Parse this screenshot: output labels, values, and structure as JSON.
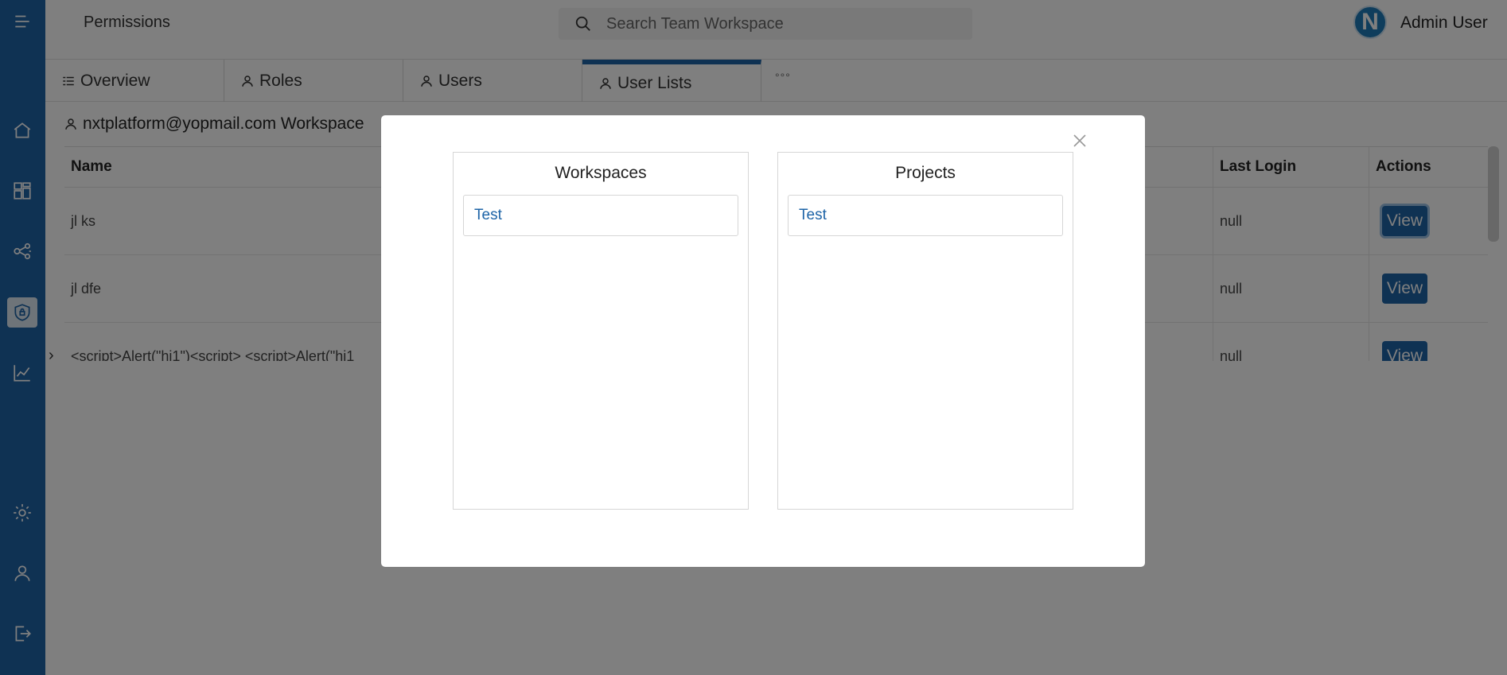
{
  "header": {
    "page_title": "Permissions",
    "search_placeholder": "Search Team Workspace",
    "avatar_letter": "N",
    "user_name": "Admin User"
  },
  "sidebar": {
    "items": [
      {
        "icon": "menu-icon"
      },
      {
        "icon": "home-icon"
      },
      {
        "icon": "dashboard-icon"
      },
      {
        "icon": "network-icon"
      },
      {
        "icon": "shield-lock-icon",
        "active": true
      },
      {
        "icon": "chart-icon"
      },
      {
        "icon": "gear-icon"
      },
      {
        "icon": "user-icon"
      },
      {
        "icon": "logout-icon"
      }
    ]
  },
  "tabs": {
    "overview": "Overview",
    "roles": "Roles",
    "users": "Users",
    "user_lists": "User Lists",
    "more": "°°°",
    "active": "User Lists"
  },
  "content": {
    "heading": "nxtplatform@yopmail.com Workspace",
    "columns": {
      "name": "Name",
      "last_login": "Last Login",
      "actions": "Actions"
    },
    "rows": [
      {
        "name": "jl ks",
        "last_login": "null",
        "action": "View"
      },
      {
        "name": "jl dfe",
        "last_login": "null",
        "action": "View"
      },
      {
        "name": "<script>Alert(\"hi1\")<script> <script>Alert(\"hi1",
        "last_login": "null",
        "action": "View"
      }
    ]
  },
  "modal": {
    "workspaces": {
      "title": "Workspaces",
      "items": [
        "Test"
      ]
    },
    "projects": {
      "title": "Projects",
      "items": [
        "Test"
      ]
    }
  },
  "colors": {
    "brand": "#1e64a7",
    "overlay": "rgba(0,0,0,0.5)"
  }
}
